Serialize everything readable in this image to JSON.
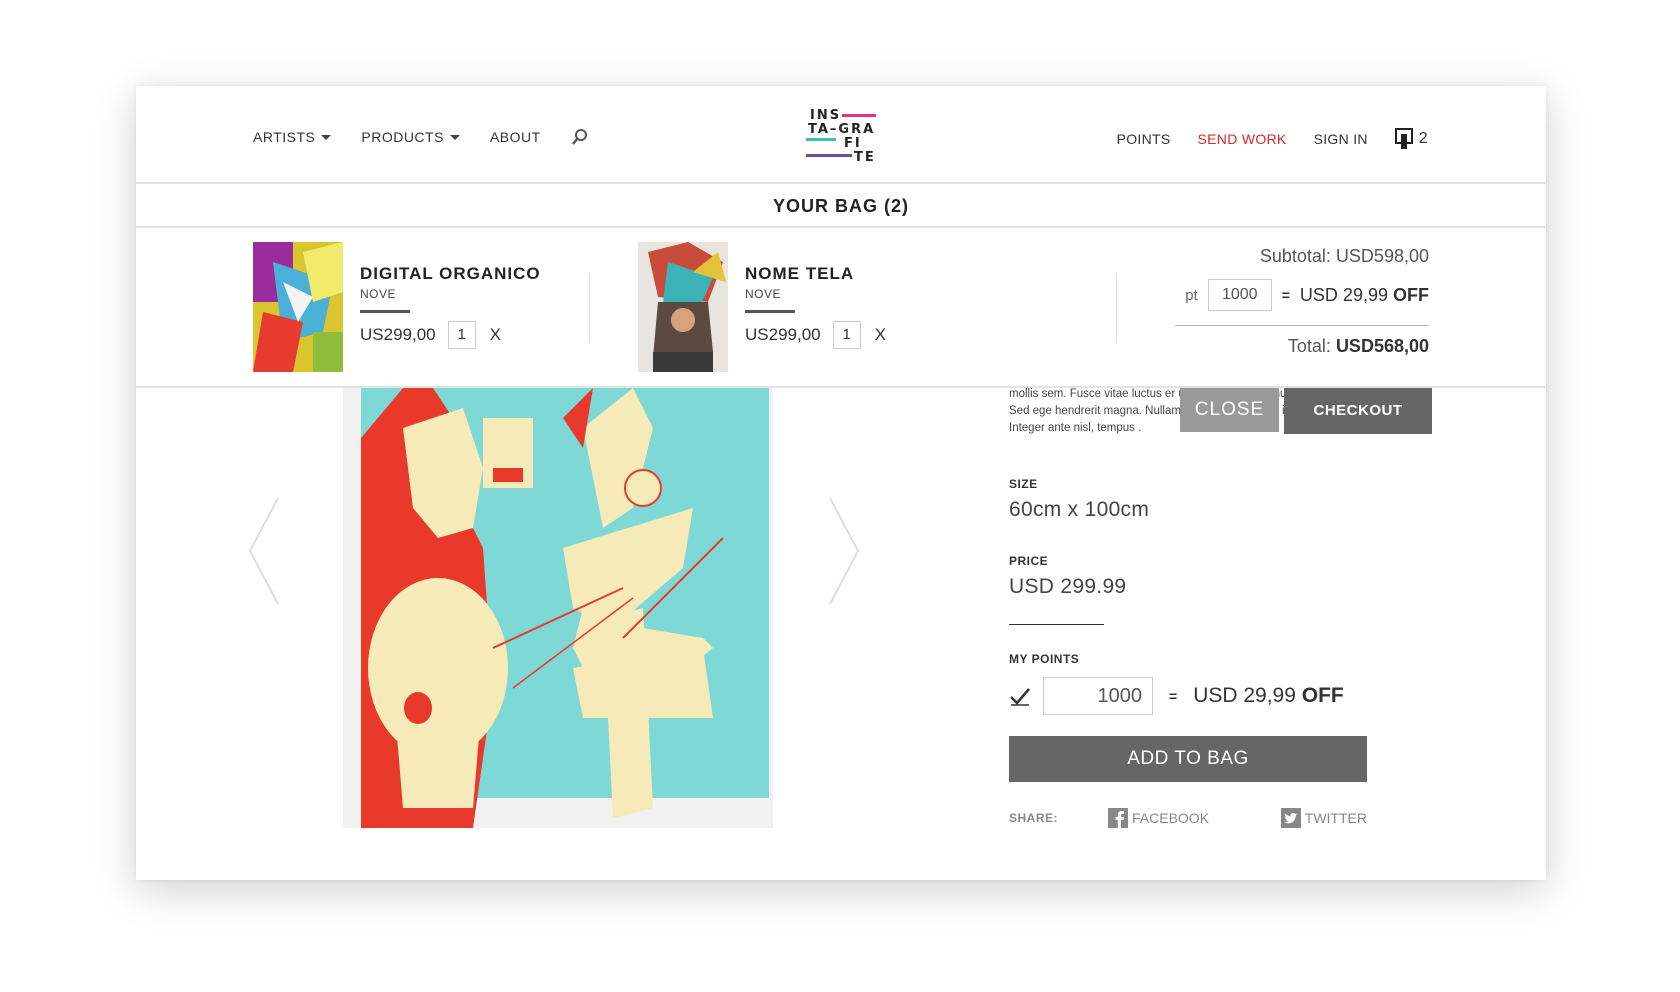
{
  "nav": {
    "artists": "ARTISTS",
    "products": "PRODUCTS",
    "about": "ABOUT",
    "points": "POINTS",
    "send_work": "SEND WORK",
    "sign_in": "SIGN IN",
    "bag_count": "2"
  },
  "logo": {
    "row1": "INS",
    "row2": "TA–GRA",
    "row3": "FI",
    "row4": "TE",
    "colors": [
      "#e5337f",
      "#f0c419",
      "#3dbfae",
      "#6b4fa2"
    ]
  },
  "bag": {
    "title": "YOUR BAG (2)",
    "items": [
      {
        "name": "DIGITAL ORGANICO",
        "artist": "NOVE",
        "price": "US299,00",
        "qty": "1",
        "remove": "X"
      },
      {
        "name": "NOME TELA",
        "artist": "NOVE",
        "price": "US299,00",
        "qty": "1",
        "remove": "X"
      }
    ],
    "subtotal": "Subtotal: USD598,00",
    "pts_label": "pt",
    "pts_value": "1000",
    "eq": "=",
    "off_amount": "USD 29,99",
    "off_word": "OFF",
    "total_label": "Total:",
    "total_value": "USD568,00",
    "close": "CLOSE",
    "checkout": "CHECKOUT"
  },
  "product": {
    "description": "mollis sem. Fusce vitae luctus er urna non, egestas nulla. Sed ege hendrerit magna. Nullam interdu ante mattis in. Integer ante nisl, tempus .",
    "size_label": "SIZE",
    "size_value": "60cm x 100cm",
    "price_label": "PRICE",
    "price_value": "USD 299.99",
    "points_label": "MY POINTS",
    "points_value": "1000",
    "eq": "=",
    "off_amount": "USD 29,99",
    "off_word": "OFF",
    "add_to_bag": "ADD TO BAG",
    "share_label": "SHARE:",
    "facebook": "FACEBOOK",
    "twitter": "TWITTER"
  }
}
